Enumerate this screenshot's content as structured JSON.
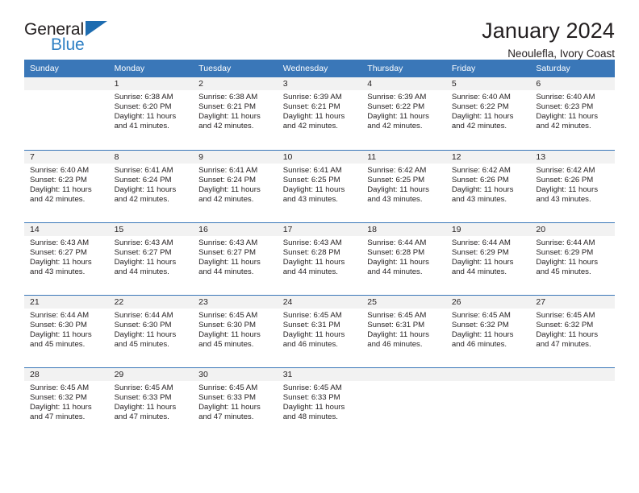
{
  "brand": {
    "line1": "General",
    "line2": "Blue",
    "triangle_color": "#1d6cb0",
    "blue_text_color": "#2f80c4"
  },
  "header": {
    "title": "January 2024",
    "location": "Neoulefla, Ivory Coast"
  },
  "theme": {
    "header_blue": "#3a77b8",
    "daynum_band": "#f2f2f2",
    "text": "#231f20"
  },
  "weekday_headers": [
    "Sunday",
    "Monday",
    "Tuesday",
    "Wednesday",
    "Thursday",
    "Friday",
    "Saturday"
  ],
  "weeks": [
    [
      {
        "day": "",
        "sunrise": "",
        "sunset": "",
        "daylight_1": "",
        "daylight_2": ""
      },
      {
        "day": "1",
        "sunrise": "Sunrise: 6:38 AM",
        "sunset": "Sunset: 6:20 PM",
        "daylight_1": "Daylight: 11 hours",
        "daylight_2": "and 41 minutes."
      },
      {
        "day": "2",
        "sunrise": "Sunrise: 6:38 AM",
        "sunset": "Sunset: 6:21 PM",
        "daylight_1": "Daylight: 11 hours",
        "daylight_2": "and 42 minutes."
      },
      {
        "day": "3",
        "sunrise": "Sunrise: 6:39 AM",
        "sunset": "Sunset: 6:21 PM",
        "daylight_1": "Daylight: 11 hours",
        "daylight_2": "and 42 minutes."
      },
      {
        "day": "4",
        "sunrise": "Sunrise: 6:39 AM",
        "sunset": "Sunset: 6:22 PM",
        "daylight_1": "Daylight: 11 hours",
        "daylight_2": "and 42 minutes."
      },
      {
        "day": "5",
        "sunrise": "Sunrise: 6:40 AM",
        "sunset": "Sunset: 6:22 PM",
        "daylight_1": "Daylight: 11 hours",
        "daylight_2": "and 42 minutes."
      },
      {
        "day": "6",
        "sunrise": "Sunrise: 6:40 AM",
        "sunset": "Sunset: 6:23 PM",
        "daylight_1": "Daylight: 11 hours",
        "daylight_2": "and 42 minutes."
      }
    ],
    [
      {
        "day": "7",
        "sunrise": "Sunrise: 6:40 AM",
        "sunset": "Sunset: 6:23 PM",
        "daylight_1": "Daylight: 11 hours",
        "daylight_2": "and 42 minutes."
      },
      {
        "day": "8",
        "sunrise": "Sunrise: 6:41 AM",
        "sunset": "Sunset: 6:24 PM",
        "daylight_1": "Daylight: 11 hours",
        "daylight_2": "and 42 minutes."
      },
      {
        "day": "9",
        "sunrise": "Sunrise: 6:41 AM",
        "sunset": "Sunset: 6:24 PM",
        "daylight_1": "Daylight: 11 hours",
        "daylight_2": "and 42 minutes."
      },
      {
        "day": "10",
        "sunrise": "Sunrise: 6:41 AM",
        "sunset": "Sunset: 6:25 PM",
        "daylight_1": "Daylight: 11 hours",
        "daylight_2": "and 43 minutes."
      },
      {
        "day": "11",
        "sunrise": "Sunrise: 6:42 AM",
        "sunset": "Sunset: 6:25 PM",
        "daylight_1": "Daylight: 11 hours",
        "daylight_2": "and 43 minutes."
      },
      {
        "day": "12",
        "sunrise": "Sunrise: 6:42 AM",
        "sunset": "Sunset: 6:26 PM",
        "daylight_1": "Daylight: 11 hours",
        "daylight_2": "and 43 minutes."
      },
      {
        "day": "13",
        "sunrise": "Sunrise: 6:42 AM",
        "sunset": "Sunset: 6:26 PM",
        "daylight_1": "Daylight: 11 hours",
        "daylight_2": "and 43 minutes."
      }
    ],
    [
      {
        "day": "14",
        "sunrise": "Sunrise: 6:43 AM",
        "sunset": "Sunset: 6:27 PM",
        "daylight_1": "Daylight: 11 hours",
        "daylight_2": "and 43 minutes."
      },
      {
        "day": "15",
        "sunrise": "Sunrise: 6:43 AM",
        "sunset": "Sunset: 6:27 PM",
        "daylight_1": "Daylight: 11 hours",
        "daylight_2": "and 44 minutes."
      },
      {
        "day": "16",
        "sunrise": "Sunrise: 6:43 AM",
        "sunset": "Sunset: 6:27 PM",
        "daylight_1": "Daylight: 11 hours",
        "daylight_2": "and 44 minutes."
      },
      {
        "day": "17",
        "sunrise": "Sunrise: 6:43 AM",
        "sunset": "Sunset: 6:28 PM",
        "daylight_1": "Daylight: 11 hours",
        "daylight_2": "and 44 minutes."
      },
      {
        "day": "18",
        "sunrise": "Sunrise: 6:44 AM",
        "sunset": "Sunset: 6:28 PM",
        "daylight_1": "Daylight: 11 hours",
        "daylight_2": "and 44 minutes."
      },
      {
        "day": "19",
        "sunrise": "Sunrise: 6:44 AM",
        "sunset": "Sunset: 6:29 PM",
        "daylight_1": "Daylight: 11 hours",
        "daylight_2": "and 44 minutes."
      },
      {
        "day": "20",
        "sunrise": "Sunrise: 6:44 AM",
        "sunset": "Sunset: 6:29 PM",
        "daylight_1": "Daylight: 11 hours",
        "daylight_2": "and 45 minutes."
      }
    ],
    [
      {
        "day": "21",
        "sunrise": "Sunrise: 6:44 AM",
        "sunset": "Sunset: 6:30 PM",
        "daylight_1": "Daylight: 11 hours",
        "daylight_2": "and 45 minutes."
      },
      {
        "day": "22",
        "sunrise": "Sunrise: 6:44 AM",
        "sunset": "Sunset: 6:30 PM",
        "daylight_1": "Daylight: 11 hours",
        "daylight_2": "and 45 minutes."
      },
      {
        "day": "23",
        "sunrise": "Sunrise: 6:45 AM",
        "sunset": "Sunset: 6:30 PM",
        "daylight_1": "Daylight: 11 hours",
        "daylight_2": "and 45 minutes."
      },
      {
        "day": "24",
        "sunrise": "Sunrise: 6:45 AM",
        "sunset": "Sunset: 6:31 PM",
        "daylight_1": "Daylight: 11 hours",
        "daylight_2": "and 46 minutes."
      },
      {
        "day": "25",
        "sunrise": "Sunrise: 6:45 AM",
        "sunset": "Sunset: 6:31 PM",
        "daylight_1": "Daylight: 11 hours",
        "daylight_2": "and 46 minutes."
      },
      {
        "day": "26",
        "sunrise": "Sunrise: 6:45 AM",
        "sunset": "Sunset: 6:32 PM",
        "daylight_1": "Daylight: 11 hours",
        "daylight_2": "and 46 minutes."
      },
      {
        "day": "27",
        "sunrise": "Sunrise: 6:45 AM",
        "sunset": "Sunset: 6:32 PM",
        "daylight_1": "Daylight: 11 hours",
        "daylight_2": "and 47 minutes."
      }
    ],
    [
      {
        "day": "28",
        "sunrise": "Sunrise: 6:45 AM",
        "sunset": "Sunset: 6:32 PM",
        "daylight_1": "Daylight: 11 hours",
        "daylight_2": "and 47 minutes."
      },
      {
        "day": "29",
        "sunrise": "Sunrise: 6:45 AM",
        "sunset": "Sunset: 6:33 PM",
        "daylight_1": "Daylight: 11 hours",
        "daylight_2": "and 47 minutes."
      },
      {
        "day": "30",
        "sunrise": "Sunrise: 6:45 AM",
        "sunset": "Sunset: 6:33 PM",
        "daylight_1": "Daylight: 11 hours",
        "daylight_2": "and 47 minutes."
      },
      {
        "day": "31",
        "sunrise": "Sunrise: 6:45 AM",
        "sunset": "Sunset: 6:33 PM",
        "daylight_1": "Daylight: 11 hours",
        "daylight_2": "and 48 minutes."
      },
      {
        "day": "",
        "sunrise": "",
        "sunset": "",
        "daylight_1": "",
        "daylight_2": ""
      },
      {
        "day": "",
        "sunrise": "",
        "sunset": "",
        "daylight_1": "",
        "daylight_2": ""
      },
      {
        "day": "",
        "sunrise": "",
        "sunset": "",
        "daylight_1": "",
        "daylight_2": ""
      }
    ]
  ]
}
